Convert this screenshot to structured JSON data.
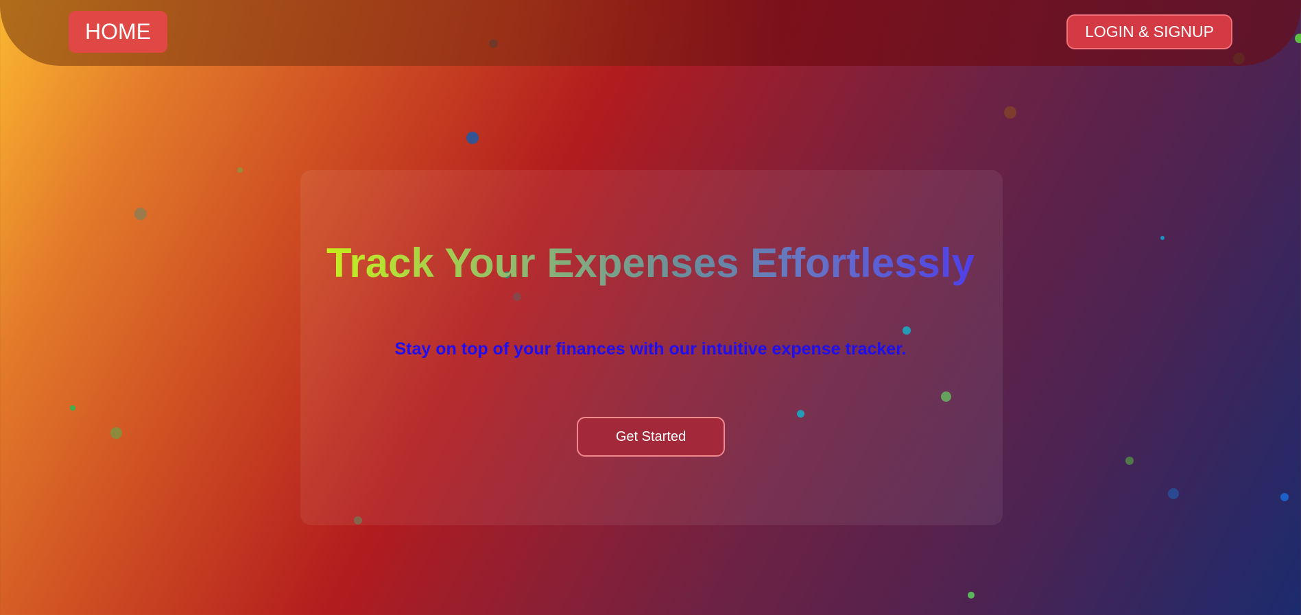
{
  "nav": {
    "home_label": "HOME",
    "login_label": "LOGIN & SIGNUP"
  },
  "hero": {
    "title": "Track Your Expenses Effortlessly",
    "subtitle": "Stay on top of your finances with our intuitive expense tracker.",
    "cta_label": "Get Started"
  },
  "colors": {
    "home_button": "#df4844",
    "login_button": "#d33a44",
    "subtitle_text": "#1e0ef0",
    "cta_button": "#a3283a",
    "title_gradient": [
      "#c6ef1d",
      "#8fb870",
      "#6a8f9c",
      "#6573c6",
      "#4e3fe9"
    ]
  }
}
